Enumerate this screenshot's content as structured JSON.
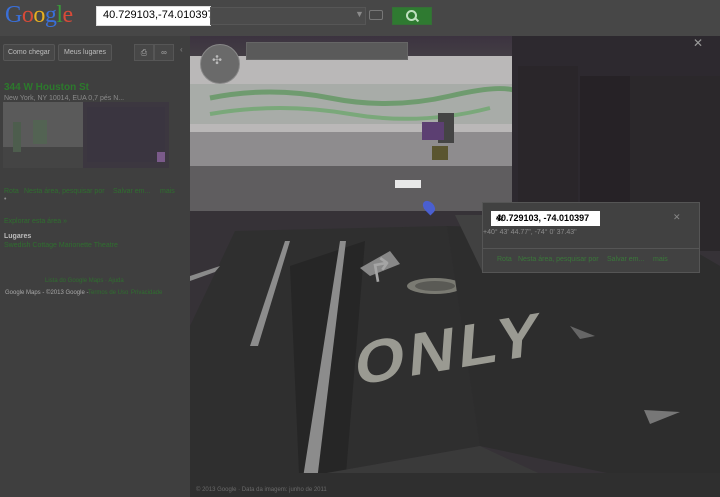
{
  "logo": "Google",
  "search": {
    "value": "40.729103,-74.010397"
  },
  "sidebar": {
    "buttons": [
      "Como chegar",
      "Meus lugares"
    ],
    "place_title": "344 W Houston St",
    "place_address": "New York, NY 10014, EUA 0,7 pés N...",
    "actions": [
      "Rota",
      "Nesta área, pesquisar por",
      "Salvar em...",
      "mais"
    ],
    "explore": "Explorar esta área »",
    "places_heading": "Lugares",
    "places_item": "Swedish Cottage Marionette Theatre",
    "footer_links": "Lista do Google Maps · Ajuda",
    "copyright": "Google Maps - ©2013 Google -",
    "terms": "Termos de Uso",
    "privacy": "Privacidade"
  },
  "streetview": {
    "road_text": "ONLY",
    "imagery_credit": "© 2013 Google · Data da imagem: junho de 2011"
  },
  "infowindow": {
    "coords": "40.729103, -74.010397",
    "dms": "+40° 43' 44.77\", -74° 0' 37.43\"",
    "links": [
      "Rota",
      "Nesta área, pesquisar por",
      "Salvar em...",
      "mais"
    ]
  },
  "colors": {
    "accent": "#2c7a2c",
    "search_button": "#2f7a31",
    "logo_blue": "#3a6fd8",
    "logo_red": "#d84a38",
    "logo_yellow": "#e8b020",
    "logo_green": "#3a9a3a"
  }
}
